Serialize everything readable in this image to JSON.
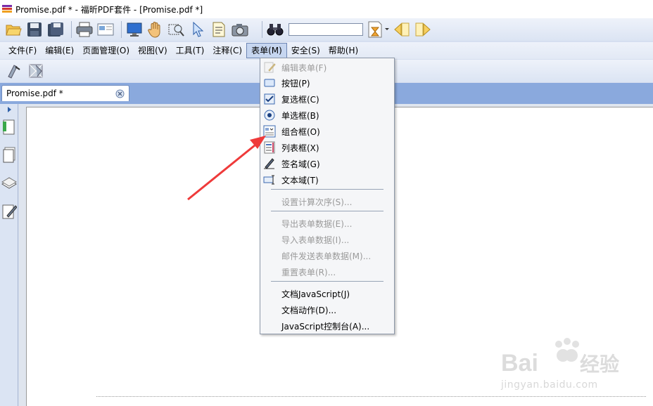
{
  "window": {
    "title": "Promise.pdf * - 福昕PDF套件 - [Promise.pdf *]"
  },
  "toolbar": {
    "buttons": [
      "open-icon",
      "save-icon",
      "save-all-icon",
      "print-icon",
      "email-icon",
      "screen-icon",
      "hand-icon",
      "zoom-select-icon",
      "pointer-icon",
      "text-select-icon",
      "snapshot-icon"
    ],
    "search_value": "",
    "search_buttons": [
      "find-icon",
      "search-options-icon",
      "prev-result-icon",
      "next-result-icon"
    ]
  },
  "menubar": {
    "items": [
      "文件(F)",
      "编辑(E)",
      "页面管理(O)",
      "视图(V)",
      "工具(T)",
      "注释(C)",
      "表单(M)",
      "安全(S)",
      "帮助(H)"
    ],
    "active_index": 6
  },
  "toolbar2": {
    "buttons": [
      "form-tool-icon",
      "form-fill-icon"
    ]
  },
  "tabs": [
    {
      "label": "Promise.pdf *"
    }
  ],
  "left_panel": {
    "buttons": [
      "expand-icon",
      "bookmarks-icon",
      "pages-icon",
      "layers-icon",
      "signatures-icon"
    ]
  },
  "form_menu": {
    "items": [
      {
        "label": "编辑表单(F)",
        "enabled": false,
        "icon": "edit-form-icon"
      },
      {
        "label": "按钮(P)",
        "enabled": true,
        "icon": "button-field-icon"
      },
      {
        "label": "复选框(C)",
        "enabled": true,
        "icon": "checkbox-icon"
      },
      {
        "label": "单选框(B)",
        "enabled": true,
        "icon": "radio-icon"
      },
      {
        "label": "组合框(O)",
        "enabled": true,
        "icon": "combo-box-icon"
      },
      {
        "label": "列表框(X)",
        "enabled": true,
        "icon": "list-box-icon"
      },
      {
        "label": "签名域(G)",
        "enabled": true,
        "icon": "signature-field-icon"
      },
      {
        "label": "文本域(T)",
        "enabled": true,
        "icon": "text-field-icon"
      },
      {
        "label": "设置计算次序(S)...",
        "enabled": false
      },
      {
        "label": "导出表单数据(E)...",
        "enabled": false
      },
      {
        "label": "导入表单数据(I)...",
        "enabled": false
      },
      {
        "label": "邮件发送表单数据(M)...",
        "enabled": false
      },
      {
        "label": "重置表单(R)...",
        "enabled": false
      },
      {
        "label": "文档JavaScript(J)",
        "enabled": true
      },
      {
        "label": "文档动作(D)...",
        "enabled": true
      },
      {
        "label": "JavaScript控制台(A)...",
        "enabled": true
      }
    ]
  },
  "annotation": {
    "arrow_color": "#ef3a3a"
  },
  "watermark": {
    "brand": "Baidu经验",
    "url": "jingyan.baidu.com"
  }
}
